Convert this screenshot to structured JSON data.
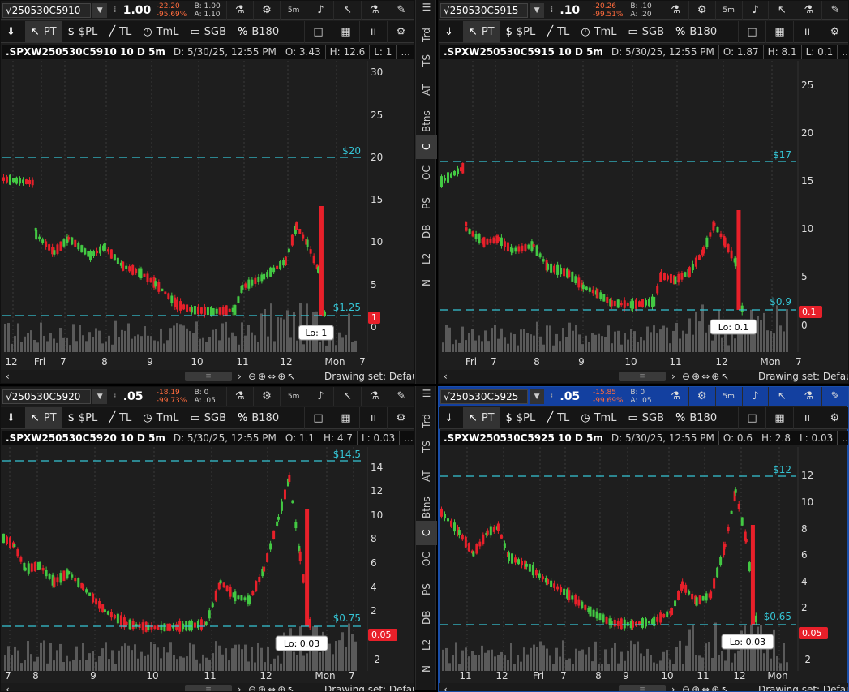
{
  "colors": {
    "accent": "#1340a0",
    "down": "#e8202a",
    "up": "#43c943",
    "level": "#35c4d4",
    "bg": "#1e1e1e"
  },
  "toolbar": {
    "items": [
      {
        "icon": "pin-icon",
        "label": ""
      },
      {
        "icon": "pointer-icon",
        "label": "PT"
      },
      {
        "icon": "dollar-icon",
        "label": "$PL"
      },
      {
        "icon": "trendline-icon",
        "label": "TL"
      },
      {
        "icon": "time-icon",
        "label": "TmL"
      },
      {
        "icon": "rectangle-icon",
        "label": "SGB"
      },
      {
        "icon": "percent-icon",
        "label": "B180"
      }
    ]
  },
  "side_tabs": [
    "Trd",
    "TS",
    "AT",
    "Btns",
    "C",
    "OC",
    "PS",
    "DB",
    "L2",
    "N"
  ],
  "side_tab_selected": "C",
  "panes": [
    {
      "symbol": "√250530C5910",
      "price": "1.00",
      "change": "-22.20",
      "change_pct": "-95.69%",
      "bid": "B: 1.00",
      "ask": "A: 1.10",
      "chart_name": ".SPXW250530C5910 10 D 5m",
      "date": "D: 5/30/25, 12:55 PM",
      "open": "O: 3.43",
      "high": "H: 12.6",
      "low": "L: 1",
      "more": "...",
      "level_label": "$20",
      "low_level_label": "$1.25",
      "last_badge": "1",
      "lo_label": "Lo: 1",
      "yticks": [
        "30",
        "25",
        "20",
        "15",
        "10",
        "5",
        "0"
      ],
      "xticks": [
        "12",
        "Fri",
        "7",
        "8",
        "9",
        "10",
        "11",
        "12",
        "Mon",
        "7"
      ],
      "drawing_set": "Drawing set: Default"
    },
    {
      "symbol": "√250530C5915",
      "price": ".10",
      "change": "-20.26",
      "change_pct": "-99.51%",
      "bid": "B: .10",
      "ask": "A: .20",
      "chart_name": ".SPXW250530C5915 10 D 5m",
      "date": "D: 5/30/25, 12:55 PM",
      "open": "O: 1.87",
      "high": "H: 8.1",
      "low": "L: 0.1",
      "more": "...",
      "level_label": "$17",
      "low_level_label": "$0.9",
      "last_badge": "0.1",
      "lo_label": "Lo: 0.1",
      "yticks": [
        "25",
        "20",
        "15",
        "10",
        "5",
        "0"
      ],
      "xticks": [
        "Fri",
        "7",
        "8",
        "9",
        "10",
        "11",
        "12",
        "Mon",
        "7"
      ],
      "drawing_set": "Drawing set: Default"
    },
    {
      "symbol": "√250530C5920",
      "price": ".05",
      "change": "-18.19",
      "change_pct": "-99.73%",
      "bid": "B: 0",
      "ask": "A: .05",
      "chart_name": ".SPXW250530C5920 10 D 5m",
      "date": "D: 5/30/25, 12:55 PM",
      "open": "O: 1.1",
      "high": "H: 4.7",
      "low": "L: 0.03",
      "more": "...",
      "level_label": "$14.5",
      "low_level_label": "$0.75",
      "last_badge": "0.05",
      "lo_label": "Lo: 0.03",
      "yticks": [
        "14",
        "12",
        "10",
        "8",
        "6",
        "4",
        "2",
        "0",
        "-2"
      ],
      "xticks": [
        "7",
        "8",
        "9",
        "10",
        "11",
        "12",
        "Mon",
        "7"
      ],
      "drawing_set": "Drawing set: Default"
    },
    {
      "symbol": "√250530C5925",
      "price": ".05",
      "change": "-15.85",
      "change_pct": "-99.69%",
      "bid": "B: 0",
      "ask": "A: .05",
      "chart_name": ".SPXW250530C5925 10 D 5m",
      "date": "D: 5/30/25, 12:55 PM",
      "open": "O: 0.6",
      "high": "H: 2.8",
      "low": "L: 0.03",
      "more": "...",
      "level_label": "$12",
      "low_level_label": "$0.65",
      "last_badge": "0.05",
      "lo_label": "Lo: 0.03",
      "yticks": [
        "12",
        "10",
        "8",
        "6",
        "4",
        "2",
        "0",
        "-2"
      ],
      "xticks": [
        "11",
        "12",
        "Fri",
        "7",
        "8",
        "9",
        "10",
        "11",
        "12",
        "Mon"
      ],
      "drawing_set": "Drawing set: Default"
    }
  ]
}
